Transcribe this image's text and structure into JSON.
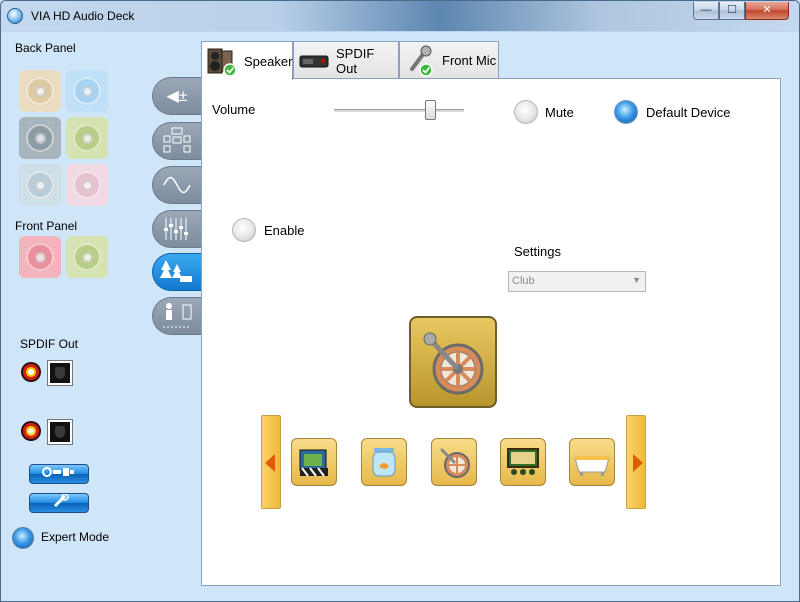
{
  "window": {
    "title": "VIA HD Audio Deck",
    "minimize": "—",
    "maximize": "☐",
    "close": "✕"
  },
  "left": {
    "back_panel_label": "Back Panel",
    "front_panel_label": "Front Panel",
    "spdif_label": "SPDIF Out",
    "expert_mode_label": "Expert Mode",
    "back_jacks": [
      "#e9dcc1",
      "#bfe0f7",
      "#a7b4bb",
      "#d4e3b0",
      "#cfdfe8",
      "#f1d9e3"
    ],
    "front_jacks": [
      "#f4b3bd",
      "#d4e3b0"
    ]
  },
  "tabs": [
    {
      "label": "Speaker",
      "active": true
    },
    {
      "label": "SPDIF Out",
      "active": false
    },
    {
      "label": "Front Mic",
      "active": false
    }
  ],
  "speaker": {
    "volume_label": "Volume",
    "volume_level": 0.7,
    "mute_label": "Mute",
    "mute_selected": false,
    "default_device_label": "Default Device",
    "default_device_selected": true,
    "enable_label": "Enable",
    "enable_selected": false,
    "settings_label": "Settings",
    "settings_value": "Club",
    "selected_preset": "club-icon",
    "presets": [
      "movie-icon",
      "fishbowl-icon",
      "club-icon",
      "theater-icon",
      "bathtub-icon"
    ]
  },
  "colors": {
    "accent": "#1279cf",
    "preset": "#e6b84a",
    "arrow": "#e15c0a"
  }
}
